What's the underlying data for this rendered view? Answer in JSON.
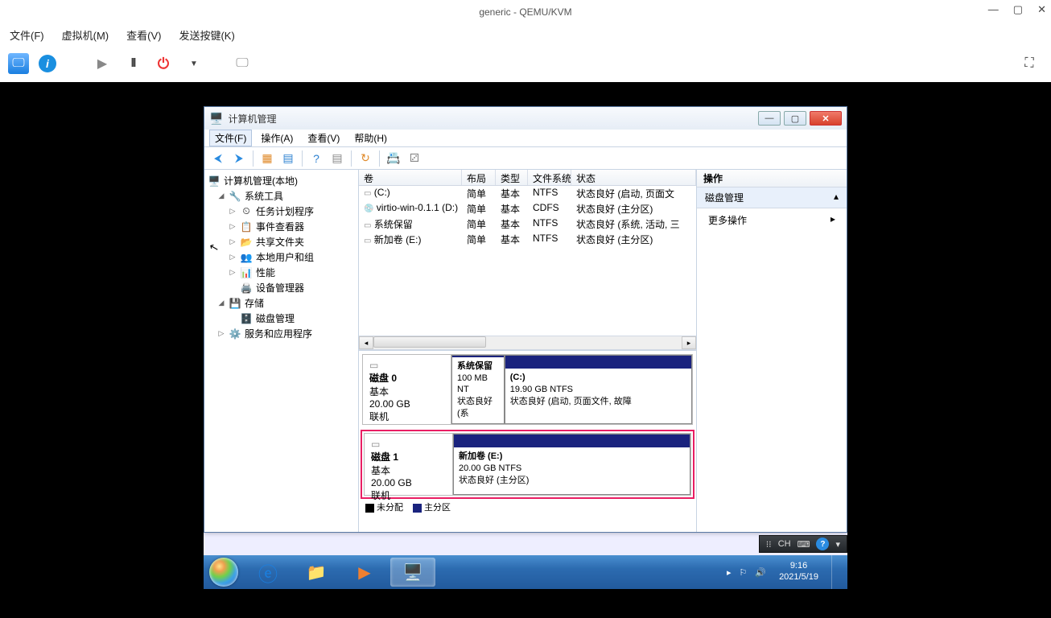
{
  "vm": {
    "title": "generic - QEMU/KVM",
    "menu": {
      "file": "文件(F)",
      "machine": "虚拟机(M)",
      "view": "查看(V)",
      "sendkey": "发送按键(K)"
    }
  },
  "mmc": {
    "title": "计算机管理",
    "menu": {
      "file": "文件(F)",
      "action": "操作(A)",
      "view": "查看(V)",
      "help": "帮助(H)"
    },
    "tree": {
      "root": "计算机管理(本地)",
      "systools": "系统工具",
      "tasksched": "任务计划程序",
      "eventvwr": "事件查看器",
      "shared": "共享文件夹",
      "localusers": "本地用户和组",
      "perf": "性能",
      "devmgr": "设备管理器",
      "storage": "存储",
      "diskmgmt": "磁盘管理",
      "services": "服务和应用程序"
    },
    "table": {
      "headers": {
        "vol": "卷",
        "layout": "布局",
        "type": "类型",
        "fs": "文件系统",
        "status": "状态"
      },
      "rows": [
        {
          "vol": "(C:)",
          "layout": "简单",
          "type": "基本",
          "fs": "NTFS",
          "status": "状态良好 (启动, 页面文"
        },
        {
          "vol": "virtio-win-0.1.1 (D:)",
          "layout": "简单",
          "type": "基本",
          "fs": "CDFS",
          "status": "状态良好 (主分区)"
        },
        {
          "vol": "系统保留",
          "layout": "简单",
          "type": "基本",
          "fs": "NTFS",
          "status": "状态良好 (系统, 活动, 三"
        },
        {
          "vol": "新加卷 (E:)",
          "layout": "简单",
          "type": "基本",
          "fs": "NTFS",
          "status": "状态良好 (主分区)"
        }
      ]
    },
    "disks": {
      "d0": {
        "name": "磁盘 0",
        "type": "基本",
        "size": "20.00 GB",
        "state": "联机",
        "p0": {
          "name": "系统保留",
          "size": "100 MB NT",
          "status": "状态良好 (系"
        },
        "p1": {
          "name": "(C:)",
          "size": "19.90 GB NTFS",
          "status": "状态良好 (启动, 页面文件, 故障"
        }
      },
      "d1": {
        "name": "磁盘 1",
        "type": "基本",
        "size": "20.00 GB",
        "state": "联机",
        "p0": {
          "name": "新加卷  (E:)",
          "size": "20.00 GB NTFS",
          "status": "状态良好 (主分区)"
        }
      }
    },
    "legend": {
      "unalloc": "未分配",
      "primary": "主分区"
    },
    "actions": {
      "hdr": "操作",
      "title": "磁盘管理",
      "more": "更多操作"
    }
  },
  "ime": {
    "lang": "CH"
  },
  "tray": {
    "time": "9:16",
    "date": "2021/5/19"
  }
}
